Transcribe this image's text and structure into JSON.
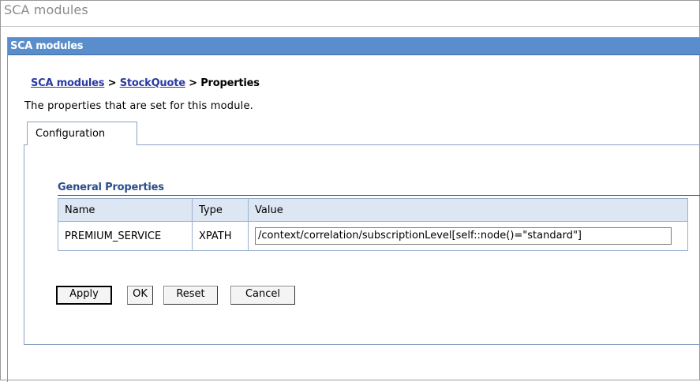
{
  "window": {
    "title": "SCA modules"
  },
  "portlet": {
    "header": "SCA modules"
  },
  "breadcrumb": {
    "items": [
      "SCA modules",
      "StockQuote",
      "Properties"
    ],
    "separator": ">"
  },
  "description": "The properties that are set for this module.",
  "tabs": [
    {
      "label": "Configuration",
      "selected": true
    }
  ],
  "general_properties": {
    "title": "General Properties",
    "columns": [
      "Name",
      "Type",
      "Value"
    ],
    "rows": [
      {
        "name": "PREMIUM_SERVICE",
        "type": "XPATH",
        "value": "/context/correlation/subscriptionLevel[self::node()=\"standard\"]"
      }
    ]
  },
  "buttons": {
    "apply": "Apply",
    "ok": "OK",
    "reset": "Reset",
    "cancel": "Cancel"
  },
  "colors": {
    "header_bg": "#5a8dcb",
    "link": "#2a3aa6",
    "section_title": "#2b4f8a",
    "table_header_bg": "#dde7f3"
  }
}
